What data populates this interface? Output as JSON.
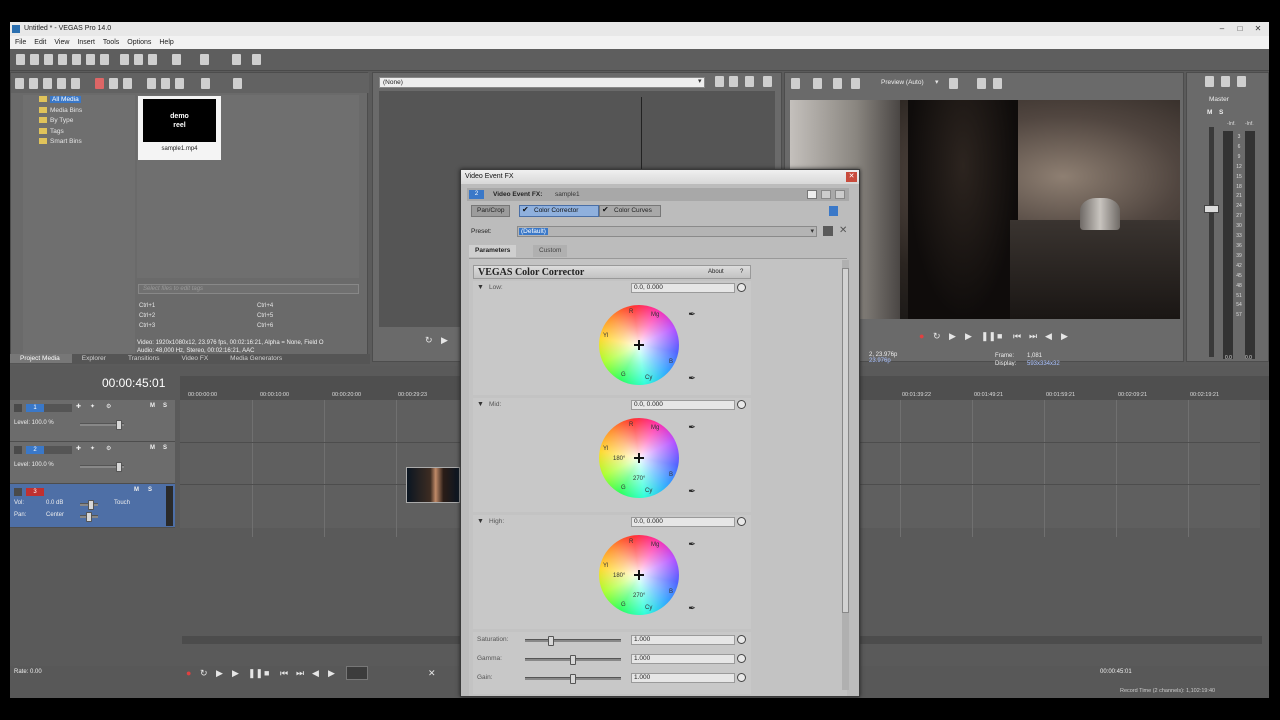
{
  "window": {
    "title": "Untitled * - VEGAS Pro 14.0"
  },
  "menu": [
    "File",
    "Edit",
    "View",
    "Insert",
    "Tools",
    "Options",
    "Help"
  ],
  "media_tree": [
    "All Media",
    "Media Bins",
    "By Type",
    "Tags",
    "Smart Bins"
  ],
  "media_file": {
    "title_line1": "demo",
    "title_line2": "reel",
    "name": "sample1.mp4"
  },
  "tag_search_placeholder": "Select files to edit tags",
  "shortcuts": [
    "Ctrl+1",
    "Ctrl+4",
    "Ctrl+2",
    "Ctrl+5",
    "Ctrl+3",
    "Ctrl+6"
  ],
  "media_info": {
    "video": "Video: 1920x1080x12, 23.976 fps, 00:02:16:21, Alpha = None, Field O",
    "audio": "Audio: 48,000 Hz, Stereo, 00:02:16:21, AAC"
  },
  "dock_tabs": [
    "Project Media",
    "Explorer",
    "Transitions",
    "Video FX",
    "Media Generators"
  ],
  "trimmer_dropdown": "(None)",
  "preview": {
    "mode": "Preview (Auto)",
    "frame_label": "Frame:",
    "frame": "1,081",
    "display_label": "Display:",
    "display": "593x334x32",
    "project": "2, 23.976p",
    "project2": "23.976p"
  },
  "master": {
    "label": "Master",
    "meter_ticks": [
      "3",
      "6",
      "9",
      "12",
      "15",
      "18",
      "21",
      "24",
      "27",
      "30",
      "33",
      "36",
      "39",
      "42",
      "45",
      "48",
      "51",
      "54",
      "57"
    ],
    "left": "0.0",
    "right": "0.0",
    "inf_l": "-Inf.",
    "inf_r": "-Inf."
  },
  "timeline": {
    "timecode": "00:00:45:01",
    "ruler": [
      "00:00:00:00",
      "00:00:10:00",
      "00:00:20:00",
      "00:00:29:23",
      "00:01:39:22",
      "00:01:49:21",
      "00:01:59:21",
      "00:02:09:21",
      "00:02:19:21"
    ],
    "tracks": [
      {
        "num": "1",
        "level": "Level: 100.0 %"
      },
      {
        "num": "2",
        "level": "Level: 100.0 %"
      },
      {
        "num": "3",
        "vol_label": "Vol:",
        "vol": "0.0 dB",
        "pan_label": "Pan:",
        "pan": "Center",
        "mode": "Touch"
      }
    ],
    "rate": "Rate: 0.00",
    "end_time": "00:00:45:01",
    "record_time": "Record Time (2 channels): 1,102:19:40"
  },
  "fx": {
    "title": "Video Event FX",
    "header_label": "Video Event FX:",
    "event_name": "sample1",
    "chain": [
      "Pan/Crop",
      "Color Corrector",
      "Color Curves"
    ],
    "preset_label": "Preset:",
    "preset_value": "(Default)",
    "tabs": [
      "Parameters",
      "Custom"
    ],
    "plugin_name": "VEGAS Color Corrector",
    "about": "About",
    "help": "?",
    "sections": [
      {
        "label": "Low:",
        "value": "0.0, 0.000"
      },
      {
        "label": "Mid:",
        "value": "0.0, 0.000"
      },
      {
        "label": "High:",
        "value": "0.0, 0.000"
      }
    ],
    "wheel_labels": {
      "r": "R",
      "mg": "Mg",
      "b": "B",
      "cy": "Cy",
      "g": "G",
      "yl": "Yl",
      "deg180": "180°",
      "deg270": "270°"
    },
    "sliders": [
      {
        "label": "Saturation:",
        "value": "1.000",
        "level": 0.25
      },
      {
        "label": "Gamma:",
        "value": "1.000",
        "level": 0.5
      },
      {
        "label": "Gain:",
        "value": "1.000",
        "level": 0.5
      }
    ]
  },
  "colors": {
    "accent": "#3a78c8",
    "selected_track": "#4e6fa6"
  }
}
